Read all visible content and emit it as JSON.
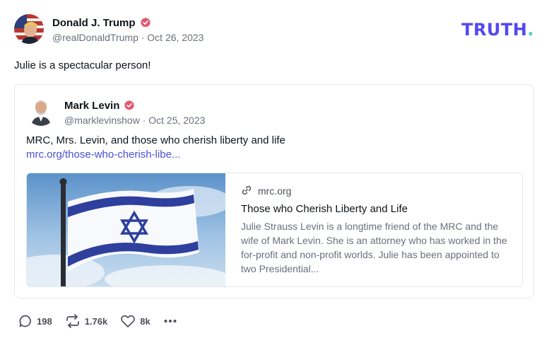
{
  "post": {
    "author_name": "Donald J. Trump",
    "handle_date": "@realDonaldTrump · Oct 26, 2023",
    "text": "Julie is a spectacular person!"
  },
  "brand": {
    "logo_main": "TRUTH",
    "logo_dot": "."
  },
  "quote": {
    "author_name": "Mark Levin",
    "handle_date": "@marklevinshow · Oct 25, 2023",
    "text": "MRC, Mrs. Levin, and those who cherish liberty and life",
    "link_text": "mrc.org/those-who-cherish-libe..."
  },
  "link_card": {
    "domain": "mrc.org",
    "title": "Those who Cherish Liberty and Life",
    "description": "Julie Strauss Levin is a longtime friend of the MRC and the wife of Mark Levin. She is an attorney who has worked in the for-profit and non-profit worlds. Julie has been appointed to two Presidential..."
  },
  "actions": {
    "replies": "198",
    "retruths": "1.76k",
    "likes": "8k"
  },
  "colors": {
    "brand": "#5448ee",
    "brand_dot": "#3fd0c5",
    "verified": "#e4556a",
    "link": "#4b4fd6"
  },
  "icons": [
    "verified-badge-icon",
    "link-icon",
    "reply-icon",
    "retruth-icon",
    "like-icon",
    "more-icon"
  ]
}
